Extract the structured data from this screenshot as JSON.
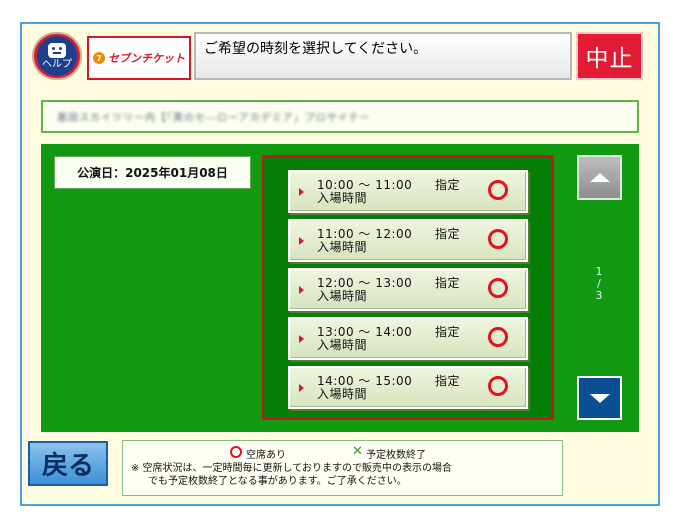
{
  "header": {
    "help_label": "ヘルプ",
    "logo_text": "セブンチケット",
    "title": "ご希望の時刻を選択してください。",
    "stop_label": "中止"
  },
  "event": {
    "name_blurred": "墨田スカイツリー内【「黒のセ―ローアカデミア」プロサイテー"
  },
  "performance": {
    "date_label": "公演日：2025年01月08日"
  },
  "slots": [
    {
      "time": "10:00 ～ 11:00",
      "tag": "指定",
      "sub": "入場時間"
    },
    {
      "time": "11:00 ～ 12:00",
      "tag": "指定",
      "sub": "入場時間"
    },
    {
      "time": "12:00 ～ 13:00",
      "tag": "指定",
      "sub": "入場時間"
    },
    {
      "time": "13:00 ～ 14:00",
      "tag": "指定",
      "sub": "入場時間"
    },
    {
      "time": "14:00 ～ 15:00",
      "tag": "指定",
      "sub": "入場時間"
    }
  ],
  "pagination": {
    "current": "1",
    "sep": "/",
    "total": "3"
  },
  "footer": {
    "back_label": "戻る",
    "legend_available": "空席あり",
    "legend_soldout": "予定枚数終了",
    "note_line1": "※ 空席状況は、一定時間毎に更新しておりますので販売中の表示の場合",
    "note_line2": "でも予定枚数終了となる事があります。ご了承ください。"
  },
  "colors": {
    "panel_green": "#119a11",
    "available_circle": "#e8101e",
    "stop_red": "#e01b33",
    "frame_bg": "#fffbe0"
  },
  "icons": {
    "help": "help-face-icon",
    "available": "circle-icon",
    "soldout": "x-mark-icon",
    "scroll_up": "triangle-up-icon",
    "scroll_down": "triangle-down-icon"
  }
}
